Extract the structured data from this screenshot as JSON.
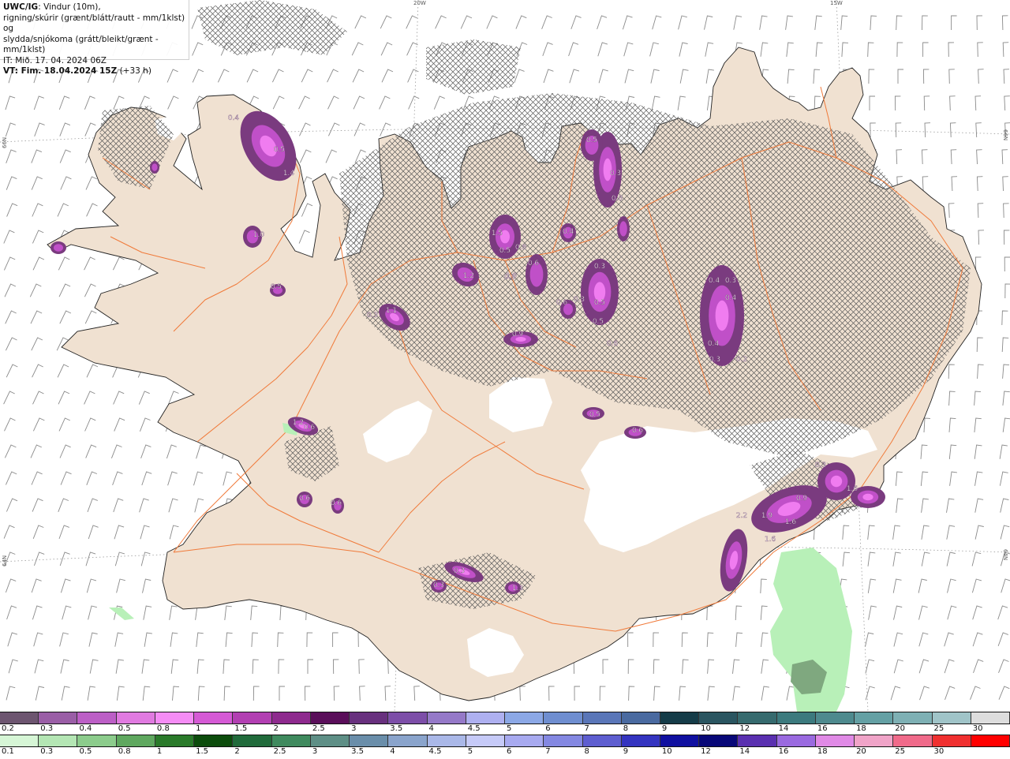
{
  "info": {
    "model": "UWC/IG",
    "line1_rest": ": Vindur (10m),",
    "line2": "rigning/skúrir (grænt/blátt/rautt - mm/1klst) og",
    "line3": "slydda/snjókoma (grátt/bleikt/grænt - mm/1klst)",
    "line4": "IT: Mið. 17. 04. 2024 06Z",
    "line5_bold": "VT: Fim. 18.04.2024 15Z",
    "line5_rest": " (+33 h)"
  },
  "grid_labels": {
    "lon_20w": "20W",
    "lon_15w": "15W",
    "lat_66n_left": "66N",
    "lat_66n_right": "66N",
    "lat_64n_left": "64N",
    "lat_64n_right": "64N"
  },
  "colors": {
    "land": "#f0e1d1",
    "glacier": "#ffffff",
    "roads": "#f07a3a",
    "coast": "#222222",
    "snow_dark": "#7a3b7f",
    "snow_mid": "#c050c8",
    "snow_light": "#f07cf0",
    "rain_light": "#b8f0b8"
  },
  "legend_snow": {
    "labels": [
      "0.2",
      "0.3",
      "0.4",
      "0.5",
      "0.8",
      "1",
      "1.5",
      "2",
      "2.5",
      "3",
      "3.5",
      "4",
      "4.5",
      "5",
      "6",
      "7",
      "8",
      "9",
      "10",
      "12",
      "14",
      "16",
      "18",
      "20",
      "25",
      "30"
    ],
    "colors": [
      "#6d5570",
      "#9a5ea6",
      "#bc5fc6",
      "#e07ae0",
      "#f58cf5",
      "#d55ad5",
      "#b23fb2",
      "#8e2a8e",
      "#5a0e5a",
      "#68307e",
      "#7d4ea8",
      "#9579c8",
      "#aeb0f0",
      "#8ca8e6",
      "#6f8ed0",
      "#5a76b8",
      "#4a6aa0",
      "#153c48",
      "#2a5560",
      "#366a6e",
      "#3c7a7e",
      "#4e8a8e",
      "#64a0a4",
      "#7eb0b4",
      "#a0c4c8",
      "#dddddd"
    ]
  },
  "legend_rain": {
    "labels": [
      "0.1",
      "0.3",
      "0.5",
      "0.8",
      "1",
      "1.5",
      "2",
      "2.5",
      "3",
      "3.5",
      "4",
      "4.5",
      "5",
      "6",
      "7",
      "8",
      "9",
      "10",
      "12",
      "14",
      "16",
      "18",
      "20",
      "25",
      "30"
    ],
    "colors": [
      "#d6f6d6",
      "#b4e6b4",
      "#8ccc8c",
      "#5fa85f",
      "#2a7a2a",
      "#0c4c0c",
      "#216b3b",
      "#3f8a5e",
      "#5e8f86",
      "#6a8eaa",
      "#8aa4cc",
      "#aab8e8",
      "#c6caf8",
      "#a8aaf0",
      "#8488e2",
      "#5e5ed0",
      "#3434c0",
      "#1010a0",
      "#080878",
      "#5a30b0",
      "#9a6ae0",
      "#e08ae6",
      "#f0a4c8",
      "#f06a8a",
      "#f03030",
      "#ff0000"
    ]
  },
  "precip_labels": [
    "0.4",
    "0.5",
    "1.4",
    "1.0",
    "0.5",
    "1.2",
    "0.3",
    "1.1",
    "0.9",
    "1.5",
    "0.5",
    "0.8",
    "0.6",
    "1.0",
    "0.3",
    "0.4",
    "0.5",
    "0.3",
    "0.8",
    "0.3",
    "0.3",
    "0.5",
    "0.5",
    "0.6",
    "0.6",
    "0.4",
    "0.3",
    "0.4",
    "0.4",
    "0.3",
    "0.2",
    "0.5",
    "0.6",
    "1.2",
    "0.6",
    "0.6",
    "0.6",
    "0.3",
    "0.3",
    "1.3",
    "0.9",
    "1.6",
    "2.2",
    "1.9",
    "1.6",
    "1.6",
    "0.3"
  ]
}
